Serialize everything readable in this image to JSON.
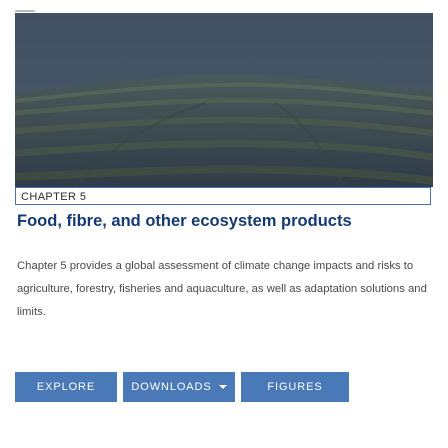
{
  "chapter": {
    "label": "CHAPTER 5",
    "title": "Food, fibre, and other ecosystem products",
    "description": "Chapter 5 provides a global assessment of climate change impacts and risks to agriculture, forestry, fisheries and aquaculture, as well as adaptation solutions and limits."
  },
  "actions": {
    "explore": "EXPLORE",
    "downloads": "DOWNLOADS",
    "figures": "FIGURES"
  },
  "icons": {
    "downloads_dropdown": "chevron-down-icon"
  },
  "colors": {
    "title": "#163a73",
    "button": "#4a79b8",
    "chapter_border": "#4a6fb5",
    "image_overlay": "#3f5062"
  }
}
